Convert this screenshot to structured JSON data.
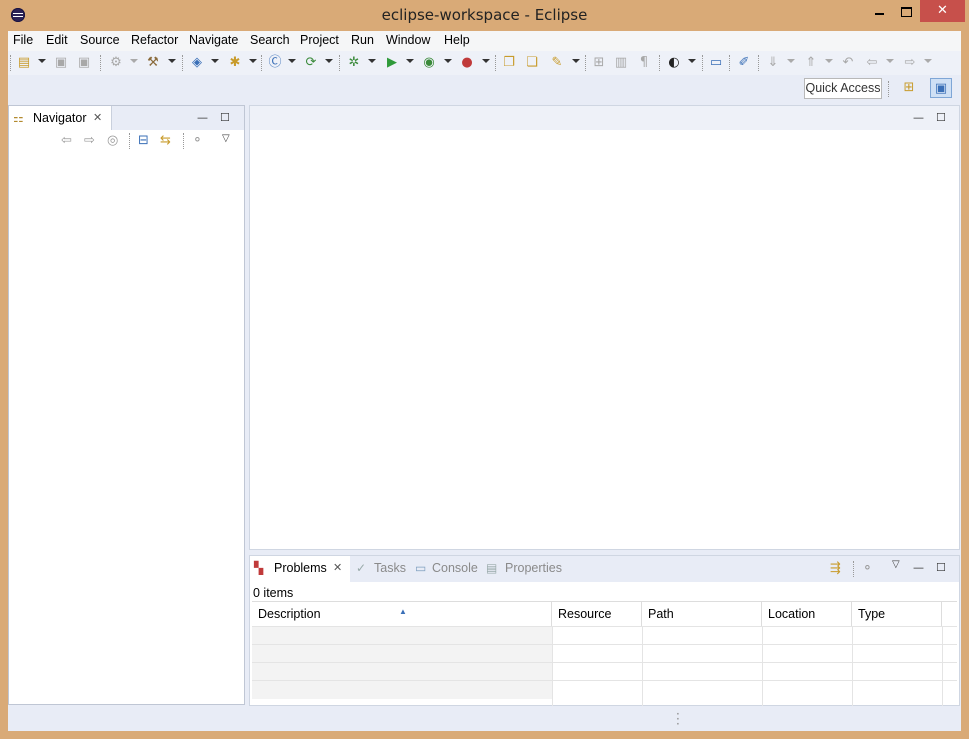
{
  "window": {
    "title": "eclipse-workspace - Eclipse",
    "close_glyph": "✕"
  },
  "menu": {
    "items": [
      "File",
      "Edit",
      "Source",
      "Refactor",
      "Navigate",
      "Search",
      "Project",
      "Run",
      "Window",
      "Help"
    ]
  },
  "toolbar": {
    "quick_access_label": "Quick Access"
  },
  "navigator": {
    "tab_label": "Navigator",
    "close_glyph": "✕",
    "minimize_glyph": "—",
    "maximize_glyph": "☐"
  },
  "editor": {
    "minimize_glyph": "—",
    "maximize_glyph": "☐"
  },
  "bottom": {
    "tabs": [
      "Problems",
      "Tasks",
      "Console",
      "Properties"
    ],
    "active_tab": "Problems",
    "close_glyph": "✕",
    "items_count": "0 items",
    "columns": [
      "Description",
      "Resource",
      "Path",
      "Location",
      "Type"
    ]
  },
  "colors": {
    "window_frame": "#d9aa77",
    "close_button": "#c7504b",
    "workbench_bg": "#e8ecf6",
    "active_accent": "#3a6fb7"
  }
}
